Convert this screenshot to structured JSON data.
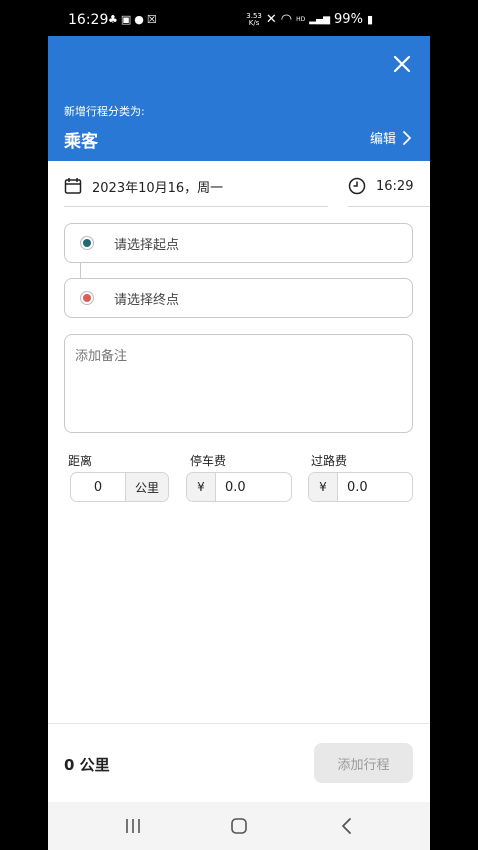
{
  "status_bar": {
    "time": "16:29",
    "speed": "3.53\nK/s",
    "battery": "99%",
    "left_icons": [
      "notification-icon",
      "gallery-icon",
      "app-icon",
      "app-icon-2"
    ],
    "right_icons": [
      "mute-icon",
      "wifi-icon",
      "hd-icon",
      "5g-signal-icon",
      "battery-icon"
    ]
  },
  "header": {
    "category_label": "新增行程分类为:",
    "category_value": "乘客",
    "edit_label": "编辑",
    "bg_color": "#2a78d6"
  },
  "trip": {
    "date": "2023年10月16，周一",
    "time": "16:29",
    "start_placeholder": "请选择起点",
    "end_placeholder": "请选择终点",
    "start_dot_color": "#1f6b74",
    "end_dot_color": "#e05a5a",
    "note_placeholder": "添加备注"
  },
  "fees": {
    "distance": {
      "label": "距离",
      "value": "0",
      "unit": "公里"
    },
    "parking": {
      "label": "停车费",
      "currency": "¥",
      "value": "0.0"
    },
    "toll": {
      "label": "过路费",
      "currency": "¥",
      "value": "0.0"
    }
  },
  "footer": {
    "total": "0 公里",
    "add_button": "添加行程"
  }
}
